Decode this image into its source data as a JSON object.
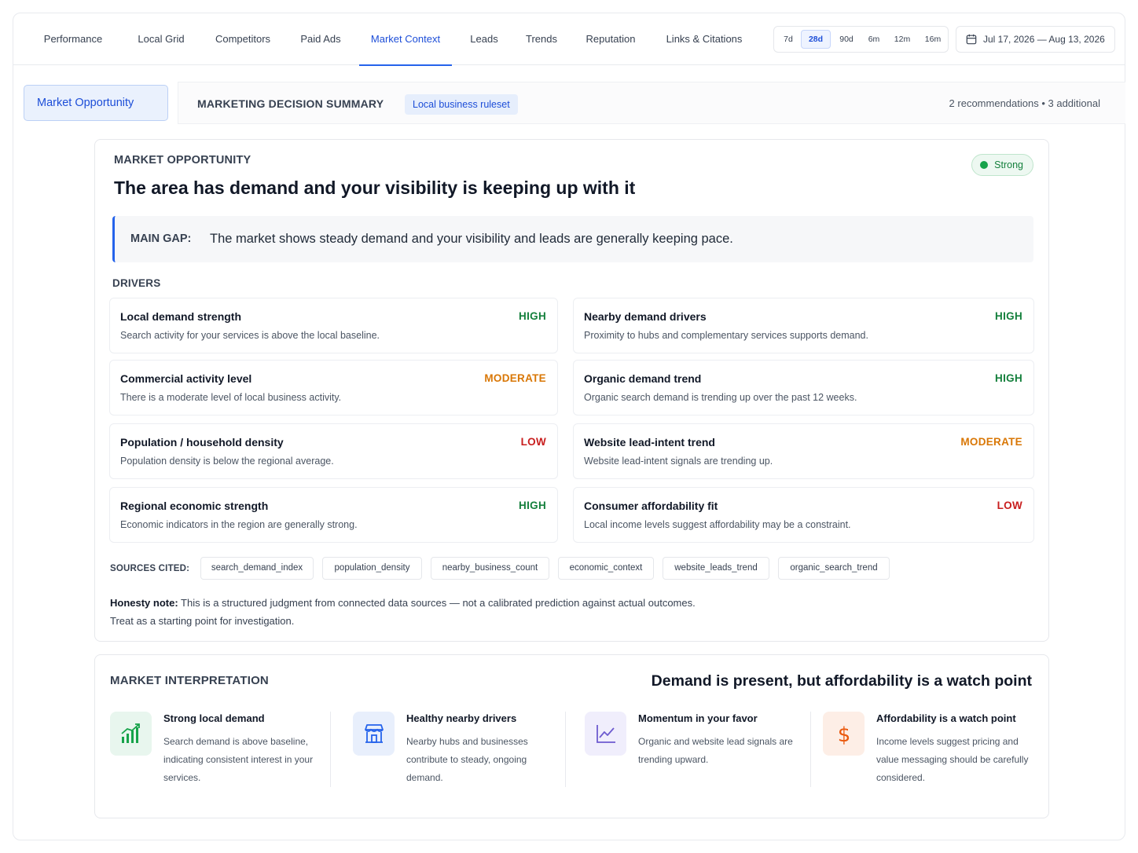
{
  "nav": {
    "tabs": [
      "Performance",
      "Local Grid",
      "Competitors",
      "Paid Ads",
      "Market Context",
      "Leads",
      "Trends",
      "Reputation",
      "Links & Citations"
    ],
    "active_tab": "Market Context",
    "ranges": [
      "7d",
      "28d",
      "90d",
      "6m",
      "12m",
      "16m"
    ],
    "active_range": "28d",
    "date_range": "Jul 17, 2026 — Aug 13, 2026"
  },
  "summary": {
    "side_tab": "Market Opportunity",
    "title": "MARKETING DECISION SUMMARY",
    "badge": "Local business ruleset",
    "right_text": "2 recommendations • 3 additional"
  },
  "opportunity": {
    "kicker": "MARKET OPPORTUNITY",
    "title": "The area has demand and your visibility is keeping up with it",
    "status": "Strong",
    "main_gap_label": "MAIN GAP:",
    "main_gap_text": "The market shows steady demand and your visibility and leads are generally keeping pace.",
    "drivers_label": "DRIVERS",
    "drivers": [
      {
        "title": "Local demand strength",
        "level": "HIGH",
        "desc": "Search activity for your services is above the local baseline."
      },
      {
        "title": "Nearby demand drivers",
        "level": "HIGH",
        "desc": "Proximity to hubs and complementary services supports demand."
      },
      {
        "title": "Commercial activity level",
        "level": "MODERATE",
        "desc": "There is a moderate level of local business activity."
      },
      {
        "title": "Organic demand trend",
        "level": "HIGH",
        "desc": "Organic search demand is trending up over the past 12 weeks."
      },
      {
        "title": "Population / household density",
        "level": "LOW",
        "desc": "Population density is below the regional average."
      },
      {
        "title": "Website lead-intent trend",
        "level": "MODERATE",
        "desc": "Website lead-intent signals are trending up."
      },
      {
        "title": "Regional economic strength",
        "level": "HIGH",
        "desc": "Economic indicators in the region are generally strong."
      },
      {
        "title": "Consumer affordability fit",
        "level": "LOW",
        "desc": "Local income levels suggest affordability may be a constraint."
      }
    ],
    "sources_label": "SOURCES CITED:",
    "sources": [
      "search_demand_index",
      "population_density",
      "nearby_business_count",
      "economic_context",
      "website_leads_trend",
      "organic_search_trend"
    ],
    "honesty_label": "Honesty note:",
    "honesty_line1": " This is a structured judgment from connected data sources — not a calibrated prediction against actual outcomes.",
    "honesty_line2": "Treat as a starting point for investigation."
  },
  "interpretation": {
    "kicker": "MARKET INTERPRETATION",
    "title": "Demand is present, but affordability is a watch point",
    "items": [
      {
        "icon": "bar-chart-icon",
        "title": "Strong local demand",
        "desc": "Search demand is above baseline, indicating consistent interest in your services."
      },
      {
        "icon": "storefront-icon",
        "title": "Healthy nearby drivers",
        "desc": "Nearby hubs and businesses contribute to steady, ongoing demand."
      },
      {
        "icon": "trend-line-icon",
        "title": "Momentum in your favor",
        "desc": "Organic and website lead signals are trending upward."
      },
      {
        "icon": "dollar-icon",
        "title": "Affordability is a watch point",
        "desc": "Income levels suggest pricing and value messaging should be carefully considered."
      }
    ]
  },
  "colors": {
    "accent": "#2563eb",
    "high": "#15803d",
    "moderate": "#d97706",
    "low": "#c81e1e"
  }
}
